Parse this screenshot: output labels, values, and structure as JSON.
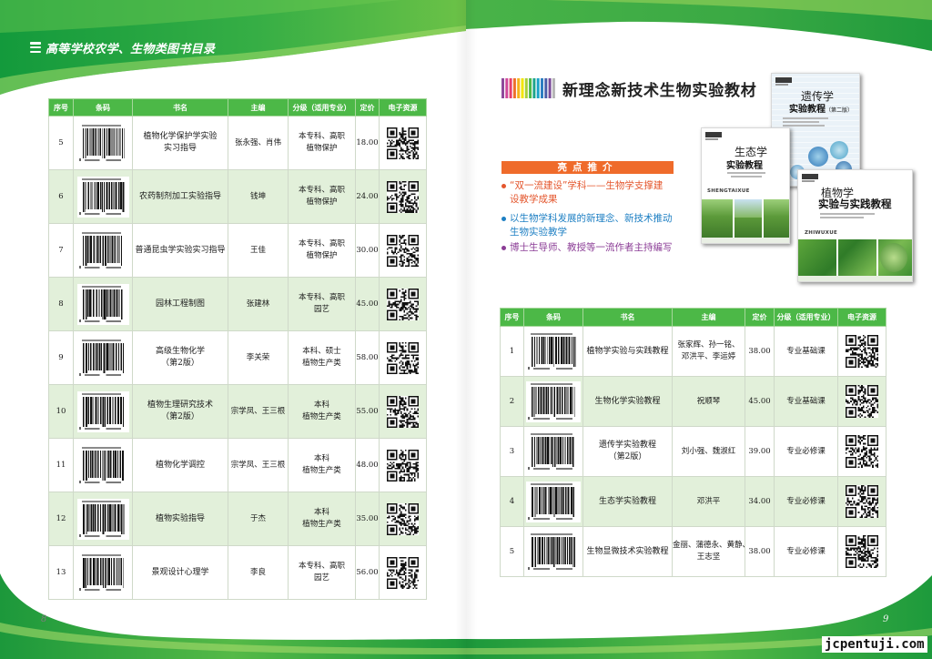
{
  "header": {
    "title": "高等学校农学、生物类图书目录",
    "icon": "menu-icon"
  },
  "left_table": {
    "columns": [
      "序号",
      "条码",
      "书名",
      "主编",
      "分级（适用专业）",
      "定价",
      "电子资源"
    ],
    "rows": [
      {
        "no": "5",
        "title": [
          "植物化学保护学实验",
          "实习指导"
        ],
        "editor": [
          "张永强、肖伟"
        ],
        "level": [
          "本专科、高职",
          "植物保护"
        ],
        "price": "18.00"
      },
      {
        "no": "6",
        "title": [
          "农药制剂加工实验指导"
        ],
        "editor": [
          "钱坤"
        ],
        "level": [
          "本专科、高职",
          "植物保护"
        ],
        "price": "24.00"
      },
      {
        "no": "7",
        "title": [
          "普通昆虫学实验实习指导"
        ],
        "editor": [
          "王佳"
        ],
        "level": [
          "本专科、高职",
          "植物保护"
        ],
        "price": "30.00"
      },
      {
        "no": "8",
        "title": [
          "园林工程制图"
        ],
        "editor": [
          "张建林"
        ],
        "level": [
          "本专科、高职",
          "园艺"
        ],
        "price": "45.00"
      },
      {
        "no": "9",
        "title": [
          "高级生物化学",
          "（第2版）"
        ],
        "editor": [
          "李关荣"
        ],
        "level": [
          "本科、硕士",
          "植物生产类"
        ],
        "price": "58.00"
      },
      {
        "no": "10",
        "title": [
          "植物生理研究技术",
          "（第2版）"
        ],
        "editor": [
          "宗学凤、王三根"
        ],
        "level": [
          "本科",
          "植物生产类"
        ],
        "price": "55.00"
      },
      {
        "no": "11",
        "title": [
          "植物化学调控"
        ],
        "editor": [
          "宗学凤、王三根"
        ],
        "level": [
          "本科",
          "植物生产类"
        ],
        "price": "48.00"
      },
      {
        "no": "12",
        "title": [
          "植物实验指导"
        ],
        "editor": [
          "于杰"
        ],
        "level": [
          "本科",
          "植物生产类"
        ],
        "price": "35.00"
      },
      {
        "no": "13",
        "title": [
          "景观设计心理学"
        ],
        "editor": [
          "李良"
        ],
        "level": [
          "本专科、高职",
          "园艺"
        ],
        "price": "56.00"
      }
    ]
  },
  "feature": {
    "title": "新理念新技术生物实验教材",
    "highlight_label": "亮点推介",
    "bullets": [
      {
        "lines": [
          "“双一流建设”学科——生物学支撑建",
          "设教学成果"
        ],
        "color": "#e4572e"
      },
      {
        "lines": [
          "以生物学科发展的新理念、新技术推动",
          "生物实验教学"
        ],
        "color": "#1d7fc3"
      },
      {
        "lines": [
          "博士生导师、教授等一流作者主持编写"
        ],
        "color": "#8b3d96"
      }
    ],
    "books": [
      {
        "title": "遗传学",
        "subtitle": "实验教程",
        "edition": "（第二版）"
      },
      {
        "title": "生态学",
        "subtitle": "实验教程",
        "pinyin": "SHENGTAIXUE"
      },
      {
        "title": "植物学",
        "subtitle": "实验与实践教程",
        "pinyin": "ZHIWUXUE"
      }
    ]
  },
  "right_table": {
    "columns": [
      "序号",
      "条码",
      "书名",
      "主编",
      "定价",
      "分级（适用专业）",
      "电子资源"
    ],
    "rows": [
      {
        "no": "1",
        "title": [
          "植物学实验与实践教程"
        ],
        "editor": [
          "张家辉、孙一铭、",
          "邓洪平、李运婷"
        ],
        "price": "38.00",
        "level": [
          "专业基础课"
        ]
      },
      {
        "no": "2",
        "title": [
          "生物化学实验教程"
        ],
        "editor": [
          "祝顺琴"
        ],
        "price": "45.00",
        "level": [
          "专业基础课"
        ]
      },
      {
        "no": "3",
        "title": [
          "遗传学实验教程",
          "（第2版）"
        ],
        "editor": [
          "刘小强、魏淑红"
        ],
        "price": "39.00",
        "level": [
          "专业必修课"
        ]
      },
      {
        "no": "4",
        "title": [
          "生态学实验教程"
        ],
        "editor": [
          "邓洪平"
        ],
        "price": "34.00",
        "level": [
          "专业必修课"
        ]
      },
      {
        "no": "5",
        "title": [
          "生物显微技术实验教程"
        ],
        "editor": [
          "金丽、蒲德永、黄静、",
          "王志坚"
        ],
        "price": "38.00",
        "level": [
          "专业必修课"
        ]
      }
    ]
  },
  "page_numbers": {
    "left": "8",
    "right": "9"
  },
  "watermark": "jcpentuji.com",
  "icons": {
    "barcode": "barcode-icon",
    "qr": "qr-code-icon",
    "rainbow": "rainbow-bars-icon"
  },
  "colors": {
    "brand_green": "#4cb847",
    "row_alt": "#e2f0da",
    "highlight_orange": "#ef6b2b"
  }
}
